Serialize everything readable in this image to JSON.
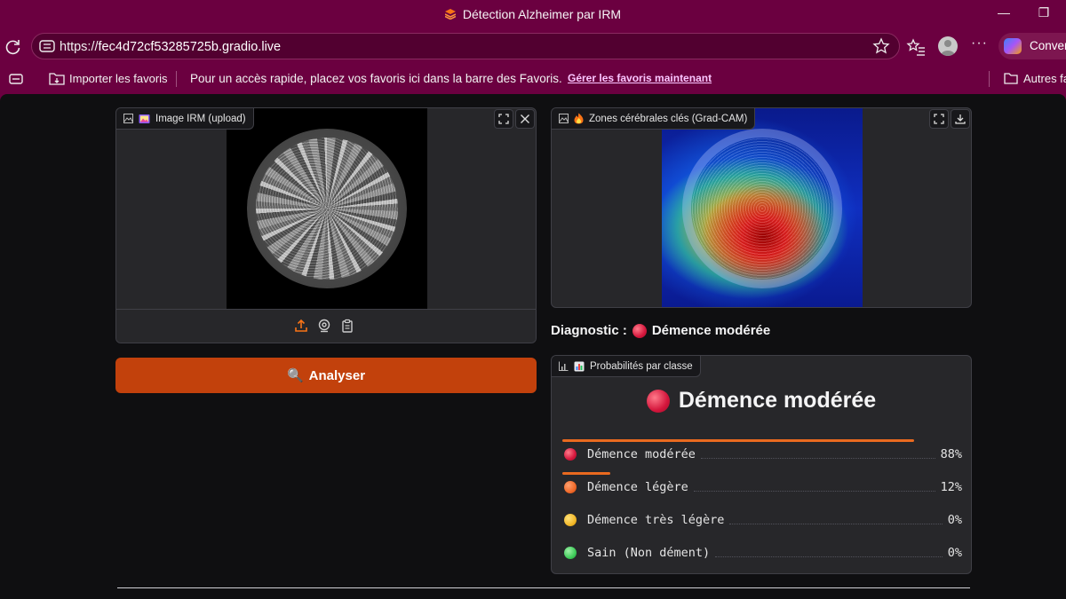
{
  "window": {
    "title": "Détection Alzheimer par IRM",
    "minimize": "—",
    "restore": "❐"
  },
  "addressbar": {
    "url_prefix": "https://",
    "url_host": "fec4d72cf53285725b.gradio.live"
  },
  "copilot": {
    "label": "Convers"
  },
  "favorites_bar": {
    "import_label": "Importer les favoris",
    "hint": "Pour un accès rapide, placez vos favoris ici dans la barre des Favoris.",
    "manage_link": "Gérer les favoris maintenant",
    "other_label": "Autres fa"
  },
  "upload_panel": {
    "label": "Image IRM (upload)",
    "icon": "framed-picture-icon"
  },
  "analyse_button": {
    "icon": "🔍",
    "label": "Analyser"
  },
  "gradcam_panel": {
    "label": "Zones cérébrales clés (Grad-CAM)",
    "icon": "fire-icon"
  },
  "diagnostic": {
    "prefix": "Diagnostic :",
    "value": "Démence modérée",
    "status_color": "#d4163c"
  },
  "probabilities_panel": {
    "label": "Probabilités par classe",
    "headline": "Démence modérée",
    "rows": [
      {
        "label": "Démence modérée",
        "value": "88%",
        "fraction": 0.88,
        "color": "red"
      },
      {
        "label": "Démence légère",
        "value": "12%",
        "fraction": 0.12,
        "color": "orange"
      },
      {
        "label": "Démence très légère",
        "value": "0%",
        "fraction": 0,
        "color": "yellow"
      },
      {
        "label": "Sain (Non dément)",
        "value": "0%",
        "fraction": 0,
        "color": "green"
      }
    ]
  },
  "colors": {
    "chrome": "#6b0040",
    "page_bg": "#0f0f11",
    "accent": "#c2410c",
    "bar": "#ea6a1f"
  }
}
